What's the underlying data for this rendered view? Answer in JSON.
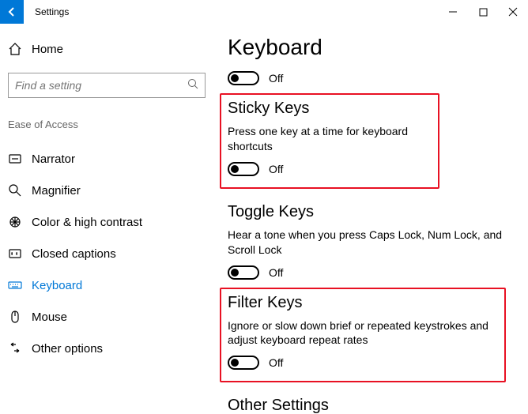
{
  "titlebar": {
    "title": "Settings"
  },
  "sidebar": {
    "home": "Home",
    "search_placeholder": "Find a setting",
    "section_header": "Ease of Access",
    "items": [
      {
        "label": "Narrator"
      },
      {
        "label": "Magnifier"
      },
      {
        "label": "Color & high contrast"
      },
      {
        "label": "Closed captions"
      },
      {
        "label": "Keyboard"
      },
      {
        "label": "Mouse"
      },
      {
        "label": "Other options"
      }
    ]
  },
  "main": {
    "title": "Keyboard",
    "top_toggle": {
      "state": "Off"
    },
    "sticky": {
      "heading": "Sticky Keys",
      "desc": "Press one key at a time for keyboard shortcuts",
      "state": "Off"
    },
    "toggle": {
      "heading": "Toggle Keys",
      "desc": "Hear a tone when you press Caps Lock, Num Lock, and Scroll Lock",
      "state": "Off"
    },
    "filter": {
      "heading": "Filter Keys",
      "desc": "Ignore or slow down brief or repeated keystrokes and adjust keyboard repeat rates",
      "state": "Off"
    },
    "other_heading": "Other Settings"
  }
}
